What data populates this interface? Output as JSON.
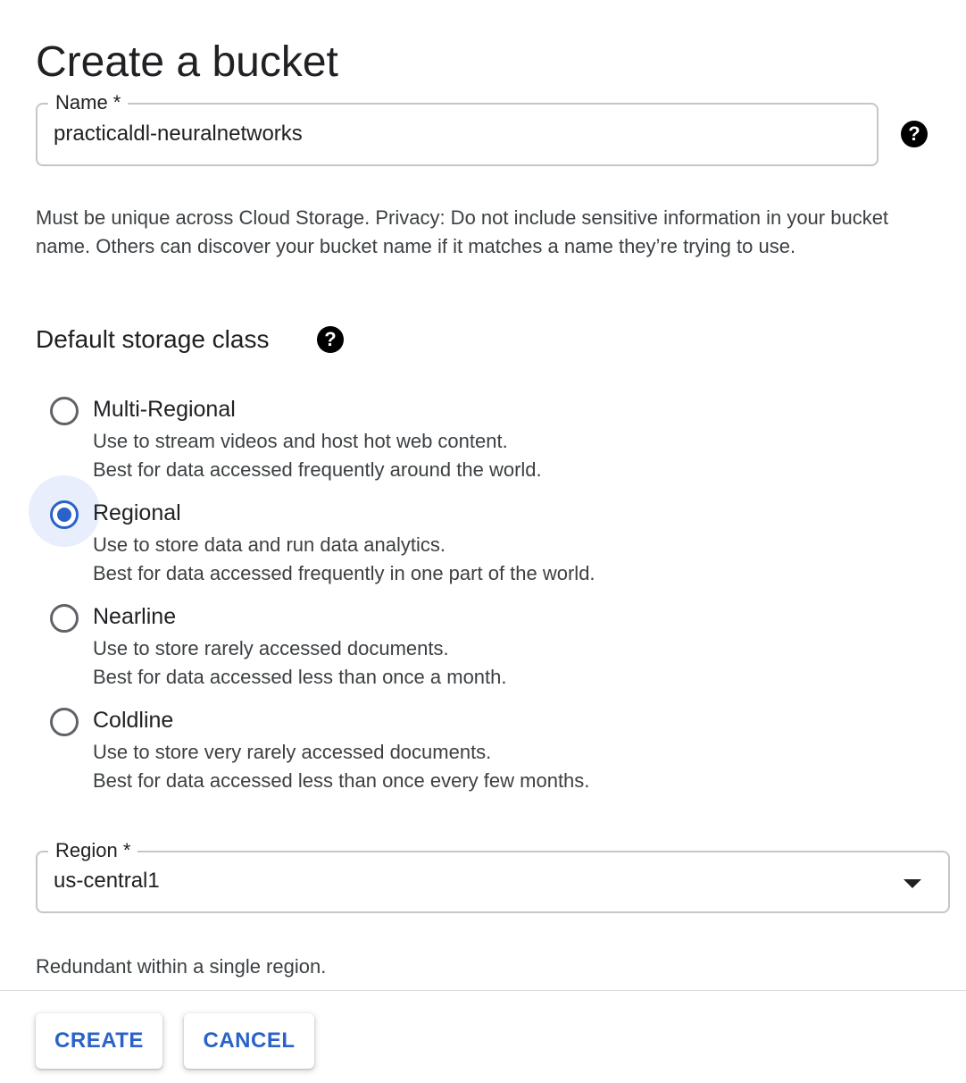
{
  "page": {
    "title": "Create a bucket"
  },
  "name_field": {
    "label": "Name  *",
    "value": "practicaldl-neuralnetworks",
    "helper": "Must be unique across Cloud Storage. Privacy: Do not include sensitive information in your bucket name. Others can discover your bucket name if it matches a name they’re trying to use."
  },
  "storage_class": {
    "title": "Default storage class",
    "options": [
      {
        "label": "Multi-Regional",
        "desc1": "Use to stream videos and host hot web content.",
        "desc2": "Best for data accessed frequently around the world.",
        "selected": false
      },
      {
        "label": "Regional",
        "desc1": "Use to store data and run data analytics.",
        "desc2": "Best for data accessed frequently in one part of the world.",
        "selected": true
      },
      {
        "label": "Nearline",
        "desc1": "Use to store rarely accessed documents.",
        "desc2": "Best for data accessed less than once a month.",
        "selected": false
      },
      {
        "label": "Coldline",
        "desc1": "Use to store very rarely accessed documents.",
        "desc2": "Best for data accessed less than once every few months.",
        "selected": false
      }
    ]
  },
  "region_field": {
    "label": "Region  *",
    "value": "us-central1",
    "helper": "Redundant within a single region."
  },
  "actions": {
    "create_label": "CREATE",
    "cancel_label": "CANCEL"
  },
  "icons": {
    "help": "help-icon",
    "dropdown": "arrow-drop-down-icon"
  },
  "colors": {
    "accent": "#2a62c9",
    "selected_halo": "#e8eefc",
    "text": "#202124",
    "secondary_text": "#3c4043",
    "border": "#c4c7c5"
  }
}
